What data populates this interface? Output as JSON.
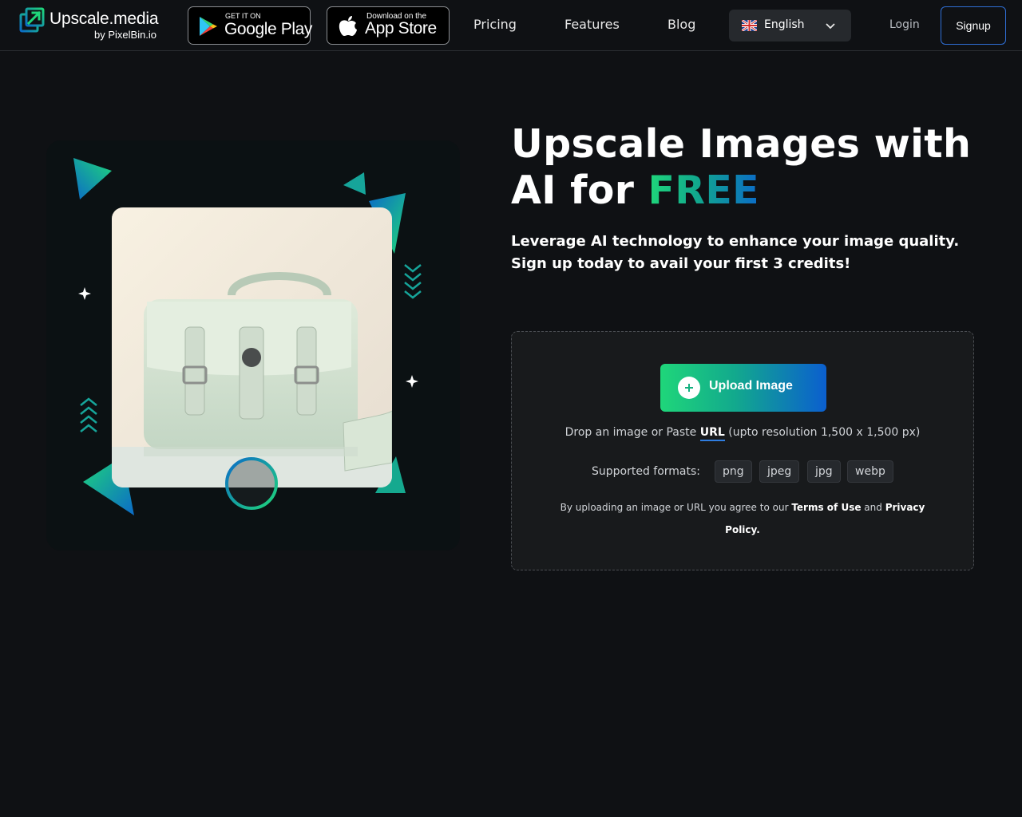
{
  "brand": {
    "name": "Upscale.media",
    "byline": "by PixelBin.io"
  },
  "stores": {
    "google": {
      "small": "GET IT ON",
      "big": "Google Play"
    },
    "apple": {
      "small": "Download on the",
      "big": "App Store"
    }
  },
  "nav": {
    "pricing": "Pricing",
    "features": "Features",
    "blog": "Blog"
  },
  "language": {
    "selected": "English",
    "flag_icon": "uk-flag-icon"
  },
  "auth": {
    "login": "Login",
    "signup": "Signup"
  },
  "hero": {
    "title_main": "Upscale Images with AI for ",
    "title_accent": "FREE",
    "subtitle_line1": "Leverage AI technology to enhance your image quality.",
    "subtitle_line2": "Sign up today to avail your first 3 credits!"
  },
  "upload": {
    "button_label": "Upload Image",
    "drop_prefix": "Drop an image or Paste ",
    "url_label": "URL",
    "drop_suffix": " (upto resolution 1,500 x 1,500 px)",
    "formats_label": "Supported formats:",
    "formats": [
      "png",
      "jpeg",
      "jpg",
      "webp"
    ],
    "terms_prefix": "By uploading an image or URL you agree to our ",
    "terms_link": "Terms of Use",
    "terms_and": " and ",
    "privacy_link": "Privacy Policy."
  },
  "colors": {
    "background": "#0f1114",
    "accent_green": "#1fd67a",
    "accent_blue": "#0b5fcf",
    "card": "#181a1c"
  }
}
